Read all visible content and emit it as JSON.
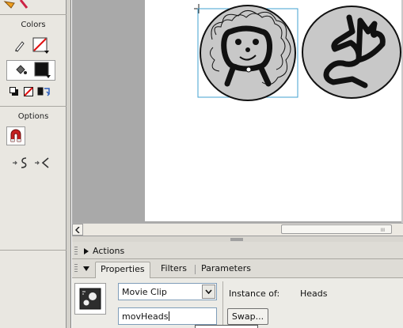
{
  "tools_panel": {
    "colors_heading": "Colors",
    "options_heading": "Options",
    "tools": [
      {
        "icon": "pencil-stroke-color-icon"
      },
      {
        "icon": "no-stroke-color-swatch-icon"
      },
      {
        "icon": "paint-bucket-fill-color-icon"
      },
      {
        "icon": "black-fill-swatch-icon"
      },
      {
        "icon": "black-and-white-icon"
      },
      {
        "icon": "no-color-icon"
      },
      {
        "icon": "swap-colors-icon"
      },
      {
        "icon": "snap-to-objects-magnet-icon"
      },
      {
        "icon": "smooth-icon"
      },
      {
        "icon": "straighten-icon"
      }
    ]
  },
  "stage": {
    "scrollbar_grip": "III"
  },
  "actions_panel": {
    "title": "Actions"
  },
  "properties_panel": {
    "tabs": [
      "Properties",
      "Filters",
      "Parameters"
    ],
    "symbol_type": "Movie Clip",
    "instance_of_label": "Instance of:",
    "instance_of_value": "Heads",
    "instance_name": "movHeads",
    "swap_button": "Swap..."
  },
  "colors": {
    "panel_bg": "#e9e7e1",
    "pasteboard": "#a9a9a9",
    "stage": "#ffffff",
    "selection": "#40a0d0",
    "head_fill": "#c8c8c8"
  }
}
